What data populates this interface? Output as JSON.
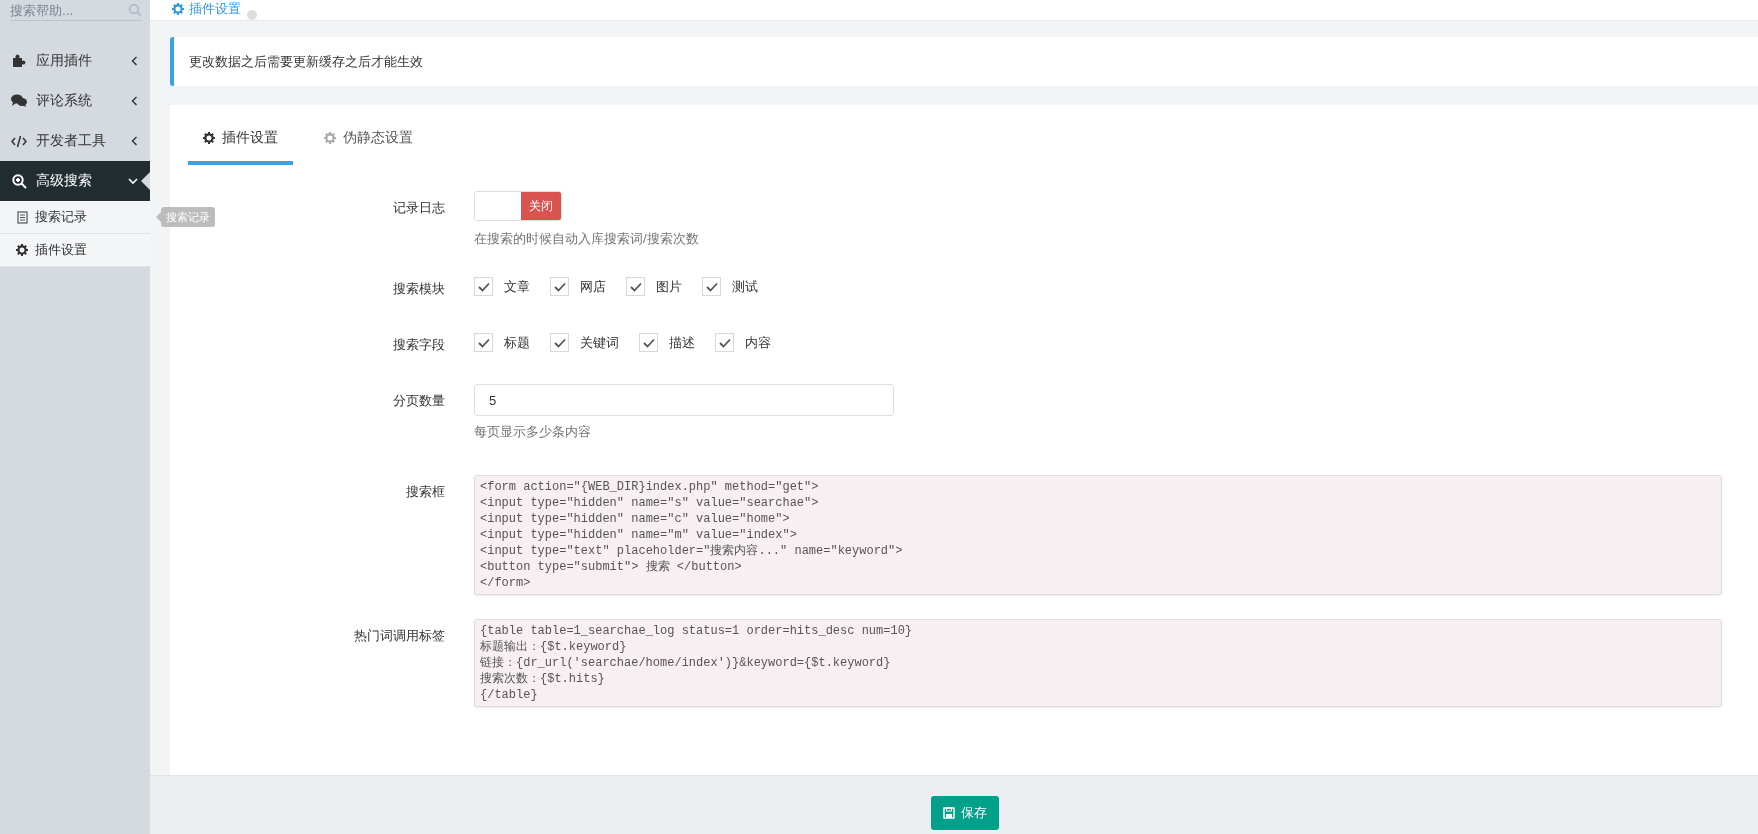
{
  "sidebar": {
    "search": {
      "placeholder": "搜索帮助..."
    },
    "items": [
      {
        "label": "应用插件",
        "selected": false,
        "expanded": false
      },
      {
        "label": "评论系统",
        "selected": false,
        "expanded": false
      },
      {
        "label": "开发者工具",
        "selected": false,
        "expanded": false
      },
      {
        "label": "高级搜索",
        "selected": true,
        "expanded": true,
        "children": [
          {
            "label": "搜索记录"
          },
          {
            "label": "插件设置"
          }
        ]
      }
    ],
    "tooltip": "搜索记录"
  },
  "breadcrumb": {
    "label": "插件设置"
  },
  "notice": "更改数据之后需要更新缓存之后才能生效",
  "tabs": [
    {
      "label": "插件设置",
      "selected": true
    },
    {
      "label": "伪静态设置",
      "selected": false
    }
  ],
  "fields": [
    {
      "kind": "toggle",
      "label": "记录日志",
      "on": false,
      "text": "关闭",
      "help": "在搜索的时候自动入库搜索词/搜索次数"
    },
    {
      "kind": "checkboxes",
      "label": "搜索模块",
      "options": [
        {
          "label": "文章",
          "checked": true
        },
        {
          "label": "网店",
          "checked": true
        },
        {
          "label": "图片",
          "checked": true
        },
        {
          "label": "测试",
          "checked": true
        }
      ]
    },
    {
      "kind": "checkboxes",
      "label": "搜索字段",
      "options": [
        {
          "label": "标题",
          "checked": true
        },
        {
          "label": "关键词",
          "checked": true
        },
        {
          "label": "描述",
          "checked": true
        },
        {
          "label": "内容",
          "checked": true
        }
      ]
    },
    {
      "kind": "input",
      "label": "分页数量",
      "value": "5",
      "help": "每页显示多少条内容"
    },
    {
      "kind": "code",
      "label": "搜索框",
      "lines": [
        "<form action=\"{WEB_DIR}index.php\" method=\"get\">",
        "<input type=\"hidden\" name=\"s\" value=\"searchae\">",
        "<input type=\"hidden\" name=\"c\" value=\"home\">",
        "<input type=\"hidden\" name=\"m\" value=\"index\">",
        "<input type=\"text\" placeholder=\"搜索内容...\" name=\"keyword\">",
        "<button type=\"submit\"> 搜索 </button>",
        "</form>"
      ]
    },
    {
      "kind": "code",
      "label": "热门词调用标签",
      "lines": [
        "{table table=1_searchae_log status=1 order=hits_desc num=10}",
        "标题输出：{$t.keyword}",
        "链接：{dr_url('searchae/home/index')}&keyword={$t.keyword}",
        "搜索次数：{$t.hits}",
        "{/table}"
      ]
    }
  ],
  "save_button": "保存"
}
